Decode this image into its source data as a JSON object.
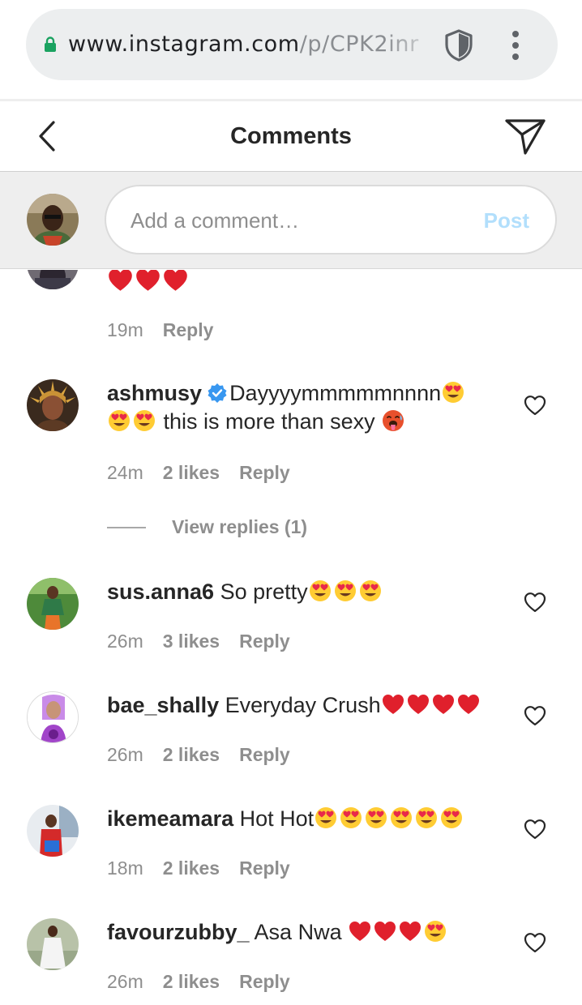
{
  "browser": {
    "url_host": "www.instagram.com",
    "url_path": "/p/CPK2inr"
  },
  "header": {
    "title": "Comments"
  },
  "composer": {
    "placeholder": "Add a comment…",
    "post_label": "Post",
    "post_color": "#b2dffc"
  },
  "colors": {
    "link_blue": "#3897f0",
    "text": "#262626",
    "meta_gray": "#8e8e8e",
    "heart_red": "#e0202c"
  },
  "comments": [
    {
      "username": "",
      "text": "",
      "emoji_after": [
        "heart",
        "heart",
        "heart"
      ],
      "time": "19m",
      "likes": "",
      "reply_label": "Reply"
    },
    {
      "username": "ashmusy",
      "verified": true,
      "text": "Dayyyymmmmmnnnn",
      "line2_text": "this is more than sexy",
      "emoji_after": [
        "heart-eyes"
      ],
      "line2_emoji_before": [
        "heart-eyes",
        "heart-eyes"
      ],
      "line2_emoji_after": [
        "hot-face"
      ],
      "time": "24m",
      "likes": "2 likes",
      "reply_label": "Reply",
      "view_replies": "View replies (1)"
    },
    {
      "username": "sus.anna6",
      "text": "So pretty",
      "emoji_after": [
        "heart-eyes",
        "heart-eyes",
        "heart-eyes"
      ],
      "time": "26m",
      "likes": "3 likes",
      "reply_label": "Reply"
    },
    {
      "username": "bae_shally",
      "text": "Everyday Crush",
      "emoji_after": [
        "heart",
        "heart",
        "heart",
        "heart"
      ],
      "time": "26m",
      "likes": "2 likes",
      "reply_label": "Reply"
    },
    {
      "username": "ikemeamara",
      "text": "Hot Hot",
      "emoji_after": [
        "heart-eyes",
        "heart-eyes",
        "heart-eyes",
        "heart-eyes",
        "heart-eyes",
        "heart-eyes"
      ],
      "time": "18m",
      "likes": "2 likes",
      "reply_label": "Reply"
    },
    {
      "username": "favourzubby_",
      "text": "Asa Nwa",
      "emoji_after": [
        "heart",
        "heart",
        "heart",
        "heart-eyes"
      ],
      "time": "26m",
      "likes": "2 likes",
      "reply_label": "Reply"
    }
  ]
}
